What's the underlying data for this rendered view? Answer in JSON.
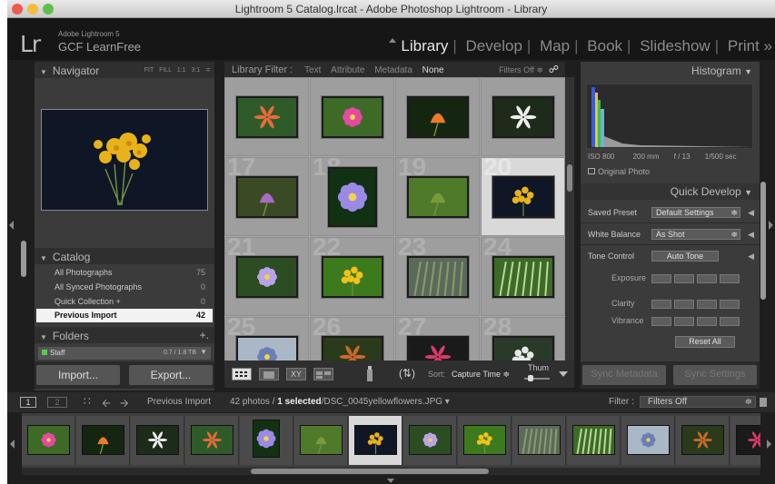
{
  "window": {
    "title": "Lightroom 5 Catalog.lrcat - Adobe Photoshop Lightroom - Library"
  },
  "identity": {
    "logo": "Lr",
    "line1": "Adobe Lightroom 5",
    "line2": "GCF LearnFree"
  },
  "modules": [
    "Library",
    "Develop",
    "Map",
    "Book",
    "Slideshow",
    "Print »"
  ],
  "active_module": "Library",
  "navigator": {
    "title": "Navigator",
    "zoom_options": [
      "FIT",
      "FILL",
      "1:1",
      "3:1 ≑"
    ]
  },
  "catalog": {
    "title": "Catalog",
    "items": [
      {
        "label": "All Photographs",
        "count": "75"
      },
      {
        "label": "All Synced Photographs",
        "count": "0"
      },
      {
        "label": "Quick Collection +",
        "count": "0"
      },
      {
        "label": "Previous Import",
        "count": "42"
      }
    ]
  },
  "folders": {
    "title": "Folders",
    "add": "+.",
    "item_label": "Staff",
    "item_size": "0.7 / 1.8 TB"
  },
  "left_buttons": {
    "import": "Import...",
    "export": "Export..."
  },
  "library_filter": {
    "label": "Library Filter :",
    "options": [
      "Text",
      "Attribute",
      "Metadata",
      "None"
    ],
    "filters_off": "Filters Off ≑"
  },
  "grid_numbers": [
    "",
    "",
    "",
    "",
    "17",
    "18",
    "19",
    "20",
    "21",
    "22",
    "23",
    "24",
    "25",
    "26",
    "27",
    "28"
  ],
  "toolbar": {
    "sort_label": "Sort:",
    "sort_value": "Capture Time ≑",
    "thumbnails_label": "Thum",
    "compare_label": "XY"
  },
  "histogram": {
    "title": "Histogram",
    "iso": "ISO 800",
    "focal": "200 mm",
    "aperture": "f / 13",
    "shutter": "1/500 sec",
    "original": "Original Photo"
  },
  "quick_develop": {
    "title": "Quick Develop",
    "saved_preset_label": "Saved Preset",
    "saved_preset_value": "Default Settings",
    "white_balance_label": "White Balance",
    "white_balance_value": "As Shot",
    "tone_control_label": "Tone Control",
    "auto_tone": "Auto Tone",
    "exposure": "Exposure",
    "clarity": "Clarity",
    "vibrance": "Vibrance",
    "reset_all": "Reset All"
  },
  "right_buttons": {
    "sync_metadata": "Sync Metadata",
    "sync_settings": "Sync Settings"
  },
  "filmstrip_bar": {
    "page1": "1",
    "page2": "2",
    "source": "Previous Import",
    "count_prefix": "42 photos /",
    "selected": "1 selected",
    "file": "/DSC_0045yellowflowers.JPG ▾",
    "filter_label": "Filter :",
    "filter_value": "Filters Off"
  },
  "colors": {
    "accent_selected": "#f2f2f2",
    "panel_bg": "#3b3b3b",
    "grid_bg": "#a8a8a8"
  }
}
